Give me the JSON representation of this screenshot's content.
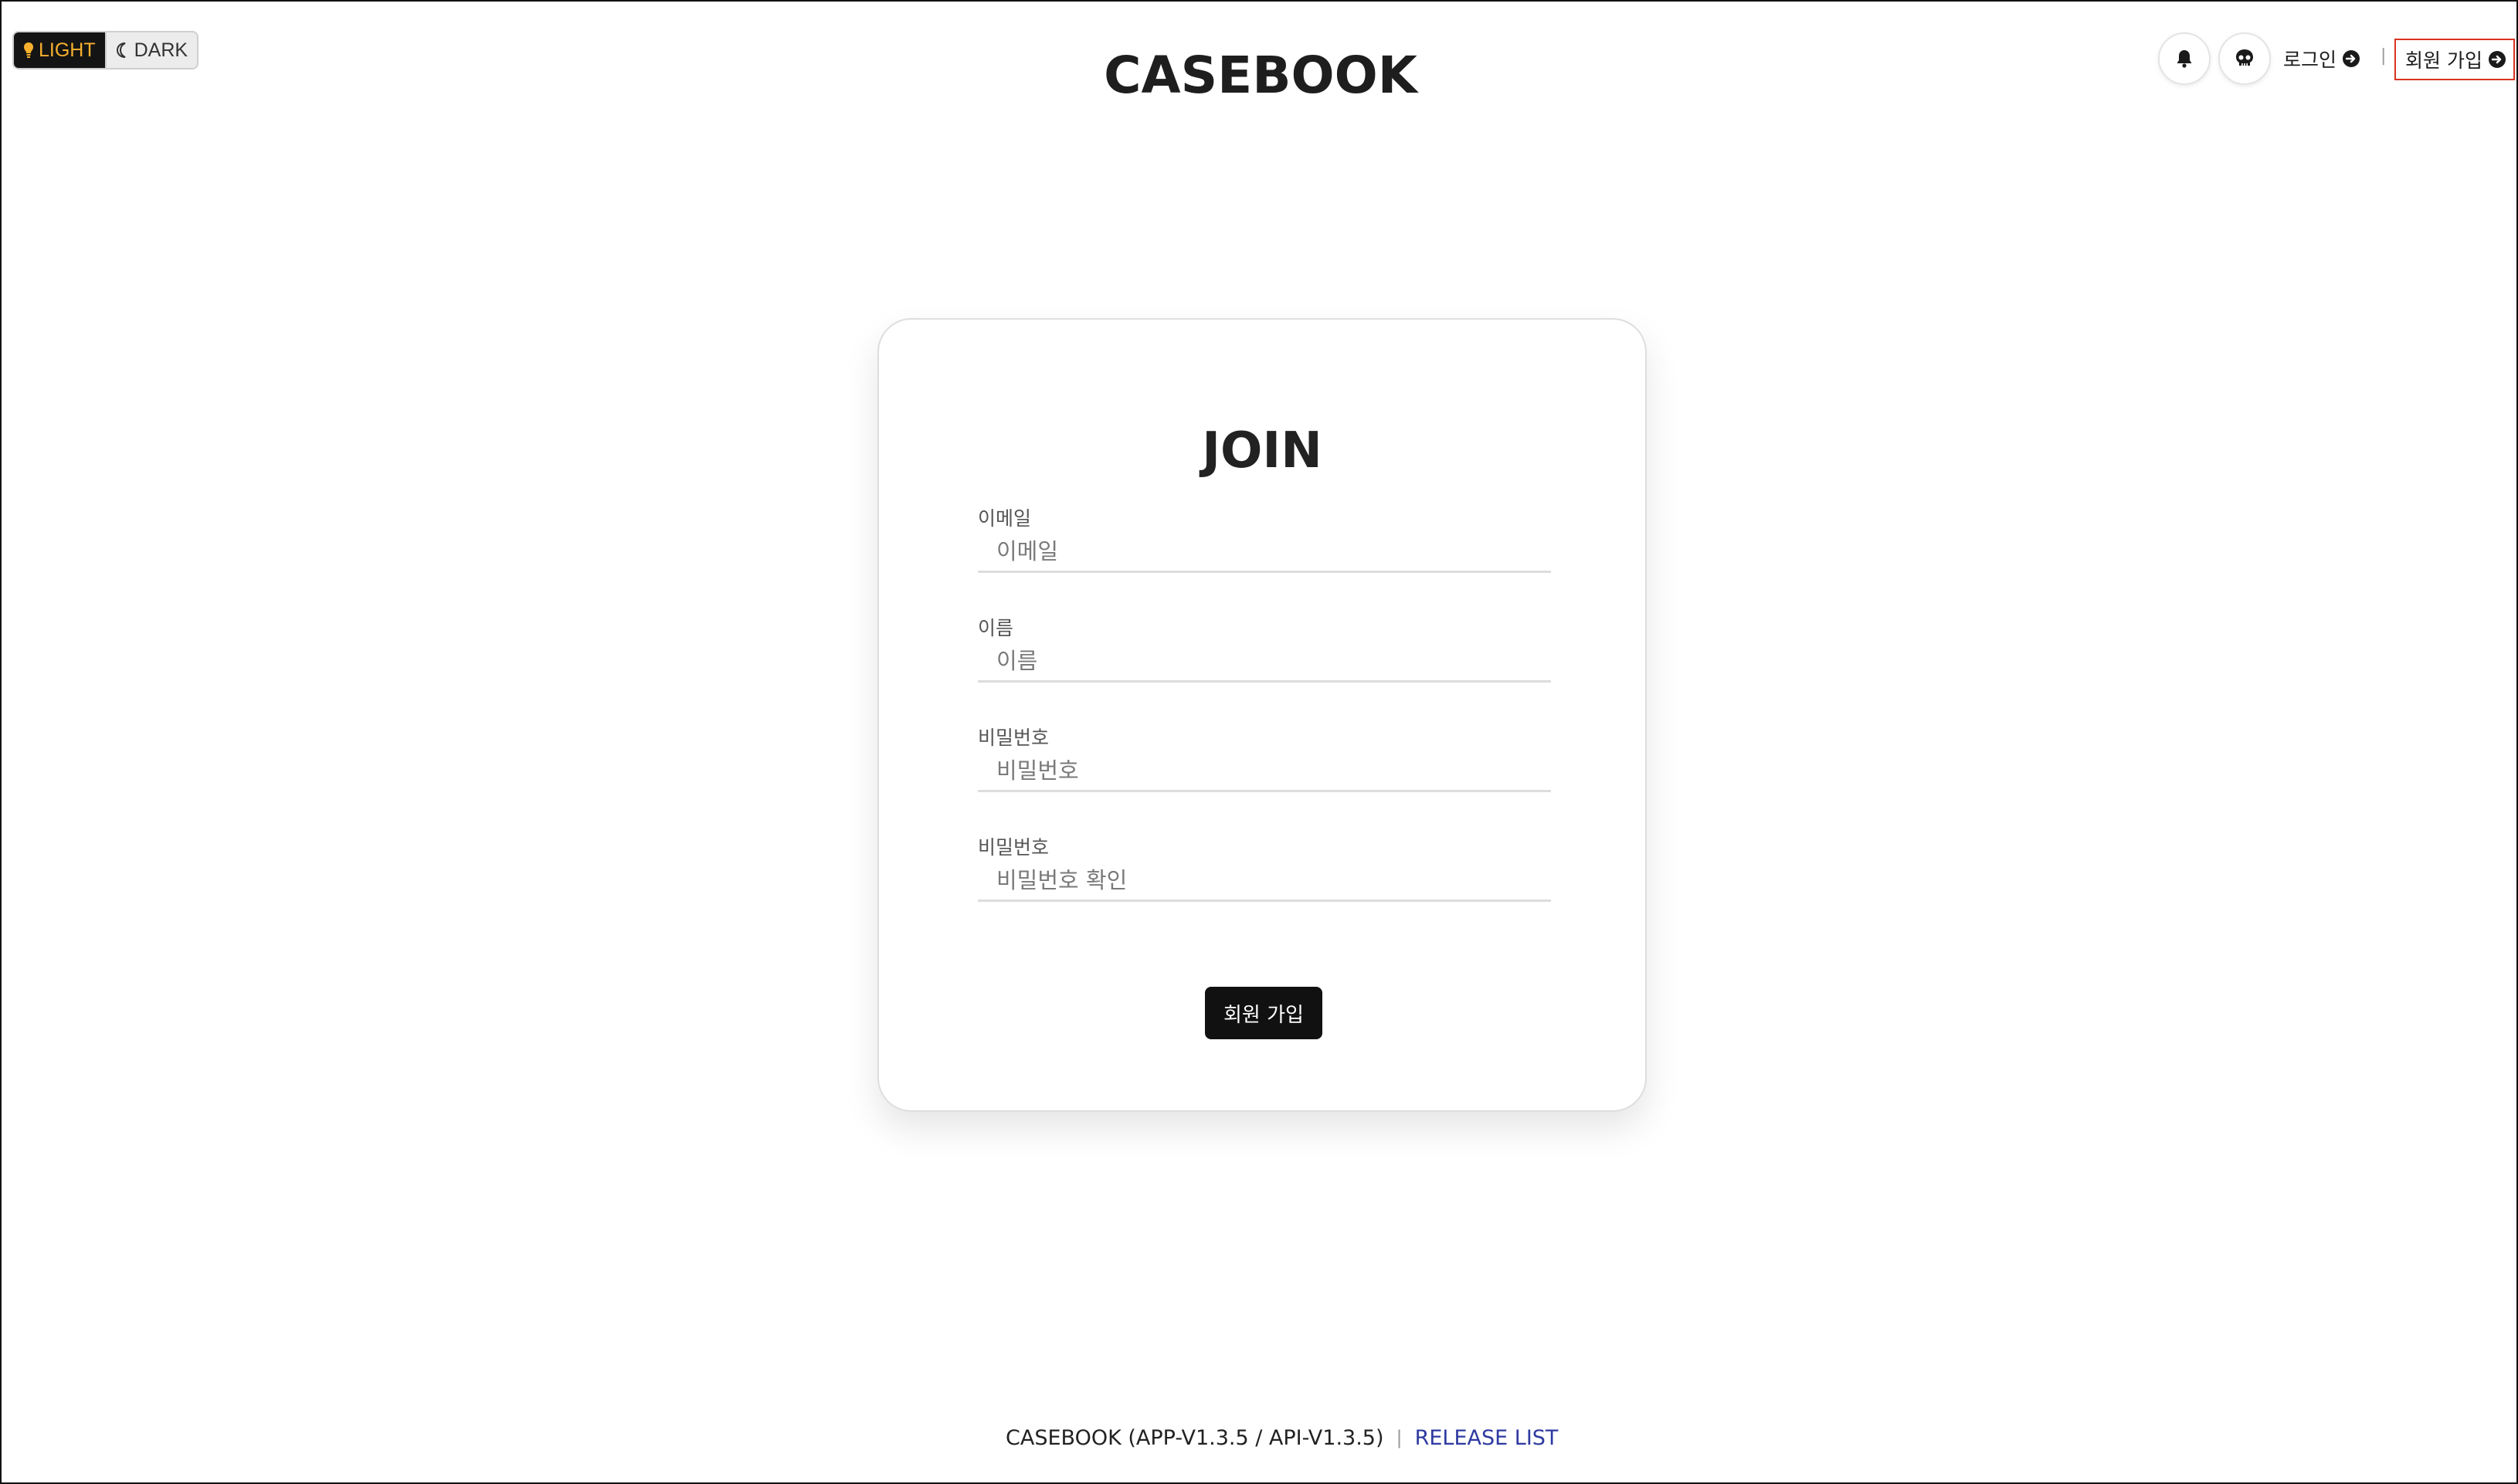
{
  "theme_toggle": {
    "light_label": "LIGHT",
    "dark_label": "DARK",
    "active": "light"
  },
  "header": {
    "logo": "CASEBOOK",
    "login_label": "로그인",
    "separator": "|",
    "join_label": "회원 가입"
  },
  "card": {
    "title": "JOIN",
    "fields": [
      {
        "label": "이메일",
        "placeholder": "이메일",
        "value": ""
      },
      {
        "label": "이름",
        "placeholder": "이름",
        "value": ""
      },
      {
        "label": "비밀번호",
        "placeholder": "비밀번호",
        "value": ""
      },
      {
        "label": "비밀번호",
        "placeholder": "비밀번호 확인",
        "value": ""
      }
    ],
    "submit_label": "회원 가입"
  },
  "footer": {
    "version": "CASEBOOK (APP-V1.3.5 / API-V1.3.5)",
    "separator": "|",
    "release_link": "RELEASE LIST"
  },
  "colors": {
    "accent_light": "#f7b02e",
    "primary": "#111111",
    "link": "#2e3aa0",
    "highlight_border": "#d9331f"
  },
  "icons": {
    "light": "lightbulb-icon",
    "dark": "moon-icon",
    "notifications": "bell-icon",
    "profile": "skull-icon",
    "login": "arrow-right-circle-icon",
    "join": "arrow-right-circle-icon"
  }
}
